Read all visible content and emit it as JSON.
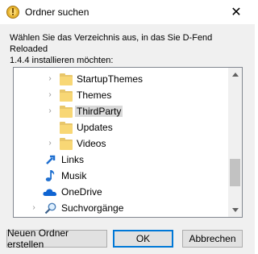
{
  "window": {
    "title": "Ordner suchen",
    "close_glyph": "✕"
  },
  "instruction": "Wählen Sie das Verzeichnis aus, in das Sie D-Fend Reloaded\n1.4.4 installieren möchten:",
  "tree": {
    "items": [
      {
        "label": "StartupThemes",
        "icon": "folder-icon",
        "expandable": true,
        "selected": false
      },
      {
        "label": "Themes",
        "icon": "folder-icon",
        "expandable": true,
        "selected": false
      },
      {
        "label": "ThirdParty",
        "icon": "folder-icon",
        "expandable": true,
        "selected": true
      },
      {
        "label": "Updates",
        "icon": "folder-icon",
        "expandable": false,
        "selected": false
      },
      {
        "label": "Videos",
        "icon": "folder-icon",
        "expandable": true,
        "selected": false
      },
      {
        "label": "Links",
        "icon": "links-icon",
        "expandable": false,
        "selected": false
      },
      {
        "label": "Musik",
        "icon": "music-icon",
        "expandable": false,
        "selected": false
      },
      {
        "label": "OneDrive",
        "icon": "onedrive-icon",
        "expandable": false,
        "selected": false
      },
      {
        "label": "Suchvorgänge",
        "icon": "search-icon",
        "expandable": true,
        "selected": false
      }
    ],
    "expander_glyph": "›"
  },
  "buttons": {
    "new_folder": "Neuen Ordner erstellen",
    "ok": "OK",
    "cancel": "Abbrechen"
  },
  "colors": {
    "accent": "#0078d7",
    "folder": "#f8d775",
    "selection": "#d9d9d9"
  }
}
